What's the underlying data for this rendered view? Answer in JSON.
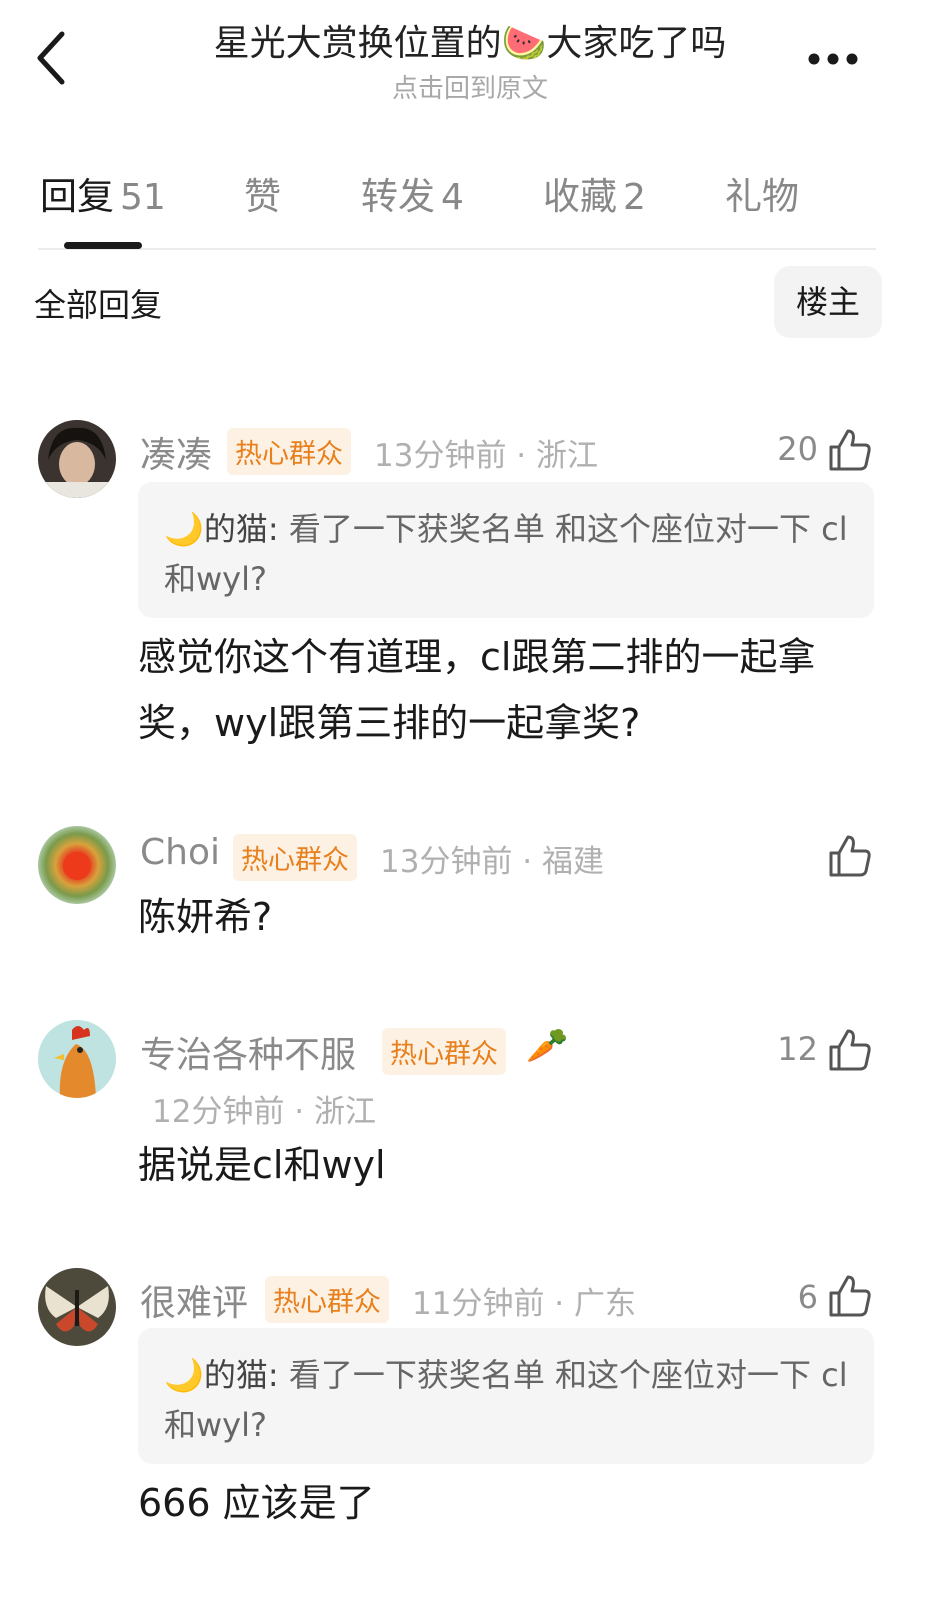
{
  "header": {
    "title": "星光大赏换位置的🍉大家吃了吗",
    "subtitle": "点击回到原文"
  },
  "tabs": [
    {
      "label": "回复",
      "count": "51"
    },
    {
      "label": "赞",
      "count": ""
    },
    {
      "label": "转发",
      "count": "4"
    },
    {
      "label": "收藏",
      "count": "2"
    },
    {
      "label": "礼物",
      "count": ""
    }
  ],
  "filter": {
    "label": "全部回复",
    "op_button": "楼主"
  },
  "colors": {
    "badge_text": "#e8801e",
    "badge_bg": "#fdf1e3",
    "meta_gray": "#b0b0b0"
  },
  "comments": [
    {
      "username": "凑凑",
      "badge": "热心群众",
      "meta": "13分钟前 · 浙江",
      "likes": "20",
      "quote": {
        "author": "🌙的猫:",
        "text": " 看了一下获奖名单 和这个座位对一下 cl和wyl?"
      },
      "body": "感觉你这个有道理，cl跟第二排的一起拿奖，wyl跟第三排的一起拿奖?"
    },
    {
      "username": "Choi",
      "badge": "热心群众",
      "meta": "13分钟前 · 福建",
      "likes": "",
      "body": "陈妍希?"
    },
    {
      "username": "专治各种不服",
      "badge": "热心群众",
      "extra_icon": "🥕",
      "meta": "12分钟前 · 浙江",
      "likes": "12",
      "body": "据说是cl和wyl"
    },
    {
      "username": "很难评",
      "badge": "热心群众",
      "meta": "11分钟前 · 广东",
      "likes": "6",
      "quote": {
        "author": "🌙的猫:",
        "text": " 看了一下获奖名单 和这个座位对一下 cl和wyl?"
      },
      "body": "666 应该是了"
    }
  ]
}
